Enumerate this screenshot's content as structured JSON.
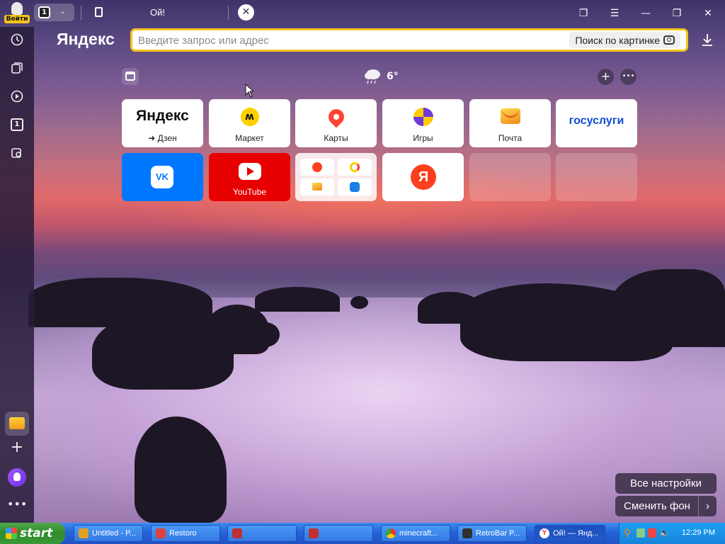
{
  "browser": {
    "login_label": "Войти",
    "tab_count": "1",
    "tab_title": "Ой!",
    "logo": "Яндекс",
    "search_placeholder": "Введите запрос или адрес",
    "image_search_label": "Поиск по картинке"
  },
  "weather": {
    "temp": "6°",
    "icon": "rain-cloud-icon"
  },
  "sidebar": {
    "items": [
      {
        "name": "history-icon"
      },
      {
        "name": "collections-icon"
      },
      {
        "name": "video-icon"
      },
      {
        "name": "tab-number-icon",
        "label": "1"
      },
      {
        "name": "screenshot-icon"
      }
    ]
  },
  "tiles": [
    {
      "name": "yandex-dzen",
      "title": "Яндекс",
      "label": "➜ Дзен"
    },
    {
      "name": "market",
      "label": "Маркет"
    },
    {
      "name": "maps",
      "label": "Карты"
    },
    {
      "name": "games",
      "label": "Игры"
    },
    {
      "name": "mail",
      "label": "Почта"
    },
    {
      "name": "gosuslugi",
      "title": "госуслуги"
    },
    {
      "name": "vk",
      "title": "VK"
    },
    {
      "name": "youtube",
      "label": "YouTube"
    },
    {
      "name": "yandex-group"
    },
    {
      "name": "yandex-ya",
      "title": "Я"
    },
    {
      "name": "empty-1"
    },
    {
      "name": "empty-2"
    }
  ],
  "buttons": {
    "all_settings": "Все настройки",
    "change_bg": "Сменить фон"
  },
  "taskbar": {
    "start": "start",
    "tasks": [
      {
        "label": "Untitled - P...",
        "icon_color": "#e0a020"
      },
      {
        "label": "Restoro",
        "icon_color": "#e04040"
      },
      {
        "label": "",
        "icon_color": "#c03030"
      },
      {
        "label": "",
        "icon_color": "#c03030"
      },
      {
        "label": "minecraft...",
        "icon_color": "#ffffff"
      },
      {
        "label": "RetroBar P...",
        "icon_color": "#303030"
      },
      {
        "label": "Ой! — Янд...",
        "icon_color": "#ffffff"
      }
    ],
    "clock": "12:29 PM"
  },
  "colors": {
    "accent": "#f5c518",
    "taskbar": "#2462d8",
    "start": "#3b9a38"
  }
}
